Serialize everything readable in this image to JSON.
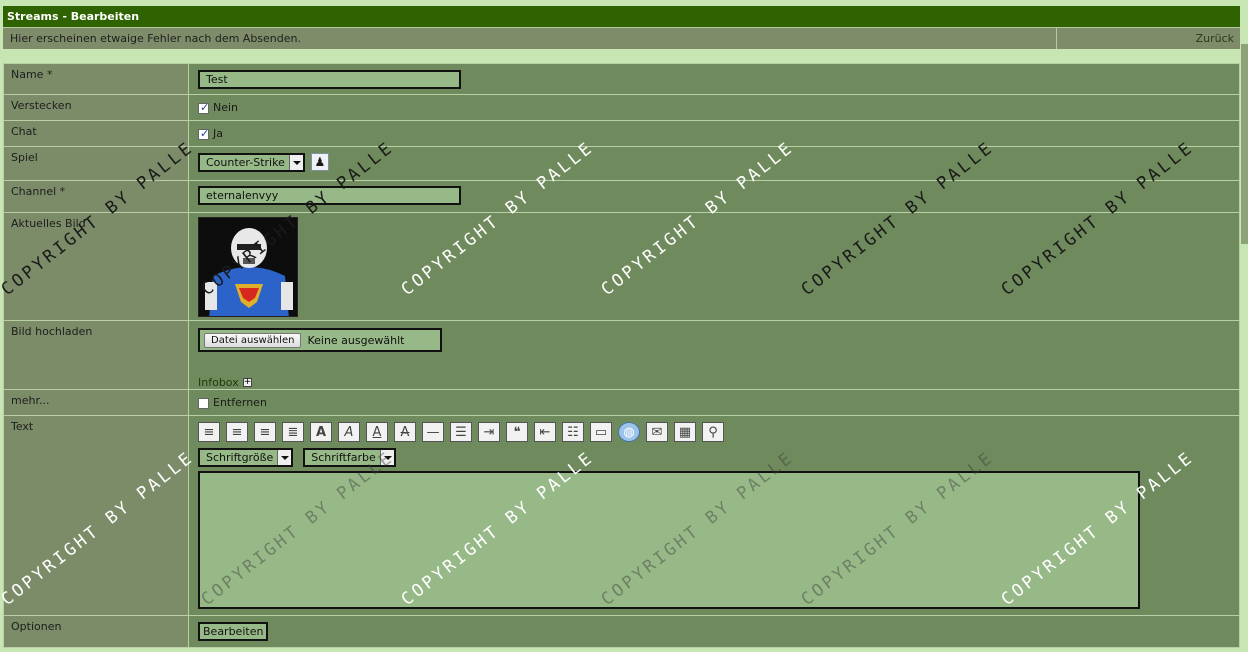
{
  "header": {
    "title": "Streams - Bearbeiten"
  },
  "infobar": {
    "message": "Hier erscheinen etwaige Fehler nach dem Absenden.",
    "back": "Zurück"
  },
  "form": {
    "name": {
      "label": "Name *",
      "value": "Test"
    },
    "hide": {
      "label": "Verstecken",
      "option": "Nein",
      "checked": true
    },
    "chat": {
      "label": "Chat",
      "option": "Ja",
      "checked": true
    },
    "game": {
      "label": "Spiel",
      "value": "Counter-Strike"
    },
    "channel": {
      "label": "Channel *",
      "value": "eternalenvyy"
    },
    "picture": {
      "label": "Aktuelles Bild"
    },
    "upload": {
      "label": "Bild hochladen",
      "button": "Datei auswählen",
      "status": "Keine ausgewählt",
      "infobox": "Infobox"
    },
    "more": {
      "label": "mehr...",
      "option": "Entfernen",
      "checked": false
    },
    "text": {
      "label": "Text",
      "font_size": "Schriftgröße",
      "font_color": "Schriftfarbe"
    },
    "options": {
      "label": "Optionen",
      "button": "Bearbeiten"
    }
  },
  "watermark": "COPYRIGHT BY PALLE"
}
